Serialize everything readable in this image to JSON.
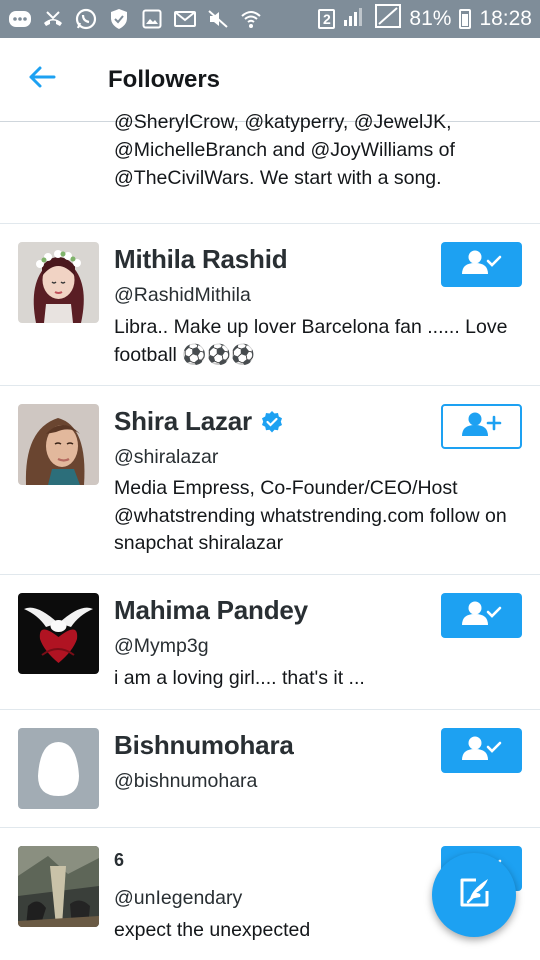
{
  "status_bar": {
    "battery": "81%",
    "time": "18:28",
    "sim_label": "2"
  },
  "header": {
    "title": "Followers"
  },
  "partial_bio": "@SherylCrow, @katyperry, @JewelJK, @MichelleBranch and @JoyWilliams of @TheCivilWars. We start with a song.",
  "followers": [
    {
      "name": "Mithila Rashid",
      "handle": "@RashidMithila",
      "bio": "Libra.. Make up lover  Barcelona fan ...... Love football ⚽⚽⚽",
      "button_state": "following"
    },
    {
      "name": "Shira Lazar",
      "handle": "@shiralazar",
      "verified": true,
      "bio": "Media Empress, Co-Founder/CEO/Host @whatstrending whatstrending.com follow on snapchat shiralazar",
      "button_state": "follow"
    },
    {
      "name": "Mahima Pandey",
      "handle": "@Mymp3g",
      "bio": "i am a loving girl.... that's it ...",
      "button_state": "following"
    },
    {
      "name": "Bishnumohara",
      "handle": "@bishnumohara",
      "bio": "",
      "button_state": "following"
    },
    {
      "name": "6",
      "handle": "@unIegendary",
      "bio": "expect the unexpected",
      "button_state": "following"
    }
  ],
  "colors": {
    "accent": "#1da1f2",
    "status_bar": "#7f8d99",
    "divider": "#e1e8ed"
  },
  "icons": {
    "back": "arrow-left-icon",
    "following": "person-check-icon",
    "follow": "person-add-icon",
    "compose": "compose-tweet-icon",
    "verified": "verified-badge-icon"
  }
}
